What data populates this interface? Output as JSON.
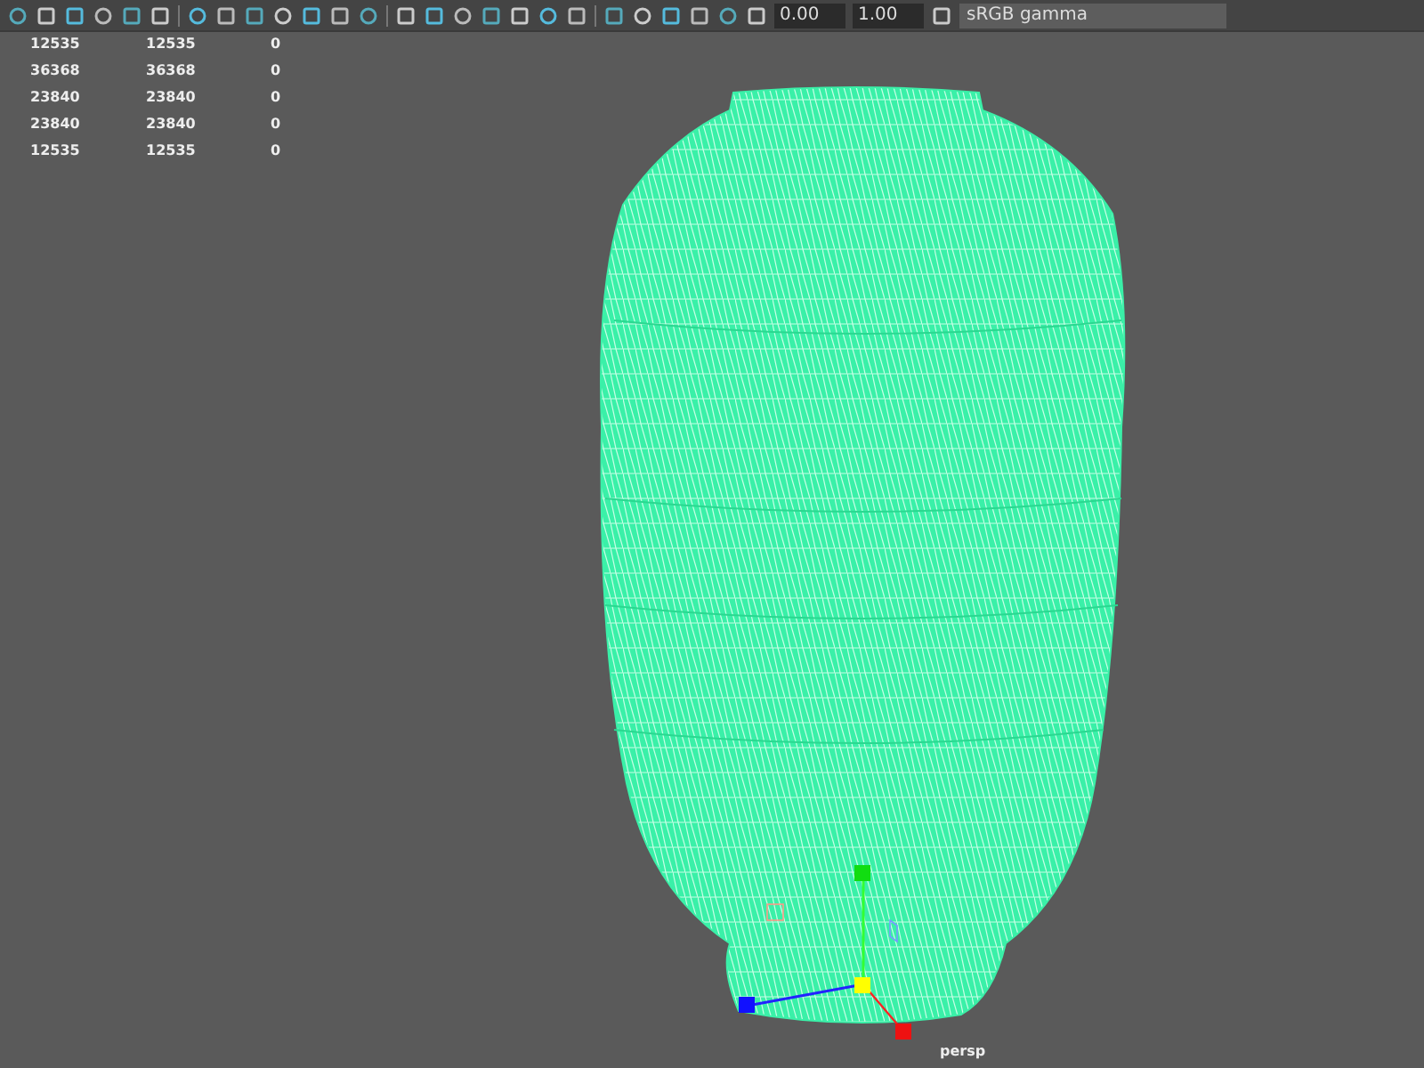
{
  "toolbar": {
    "fields": [
      {
        "kind": "number",
        "value": "0.00"
      },
      {
        "kind": "number",
        "value": "1.00"
      },
      {
        "kind": "dropdown",
        "value": "sRGB gamma"
      }
    ]
  },
  "heads_up_display": {
    "rows": [
      [
        "12535",
        "12535",
        "0"
      ],
      [
        "36368",
        "36368",
        "0"
      ],
      [
        "23840",
        "23840",
        "0"
      ],
      [
        "23840",
        "23840",
        "0"
      ],
      [
        "12535",
        "12535",
        "0"
      ]
    ]
  },
  "viewport": {
    "camera_label": "persp"
  }
}
